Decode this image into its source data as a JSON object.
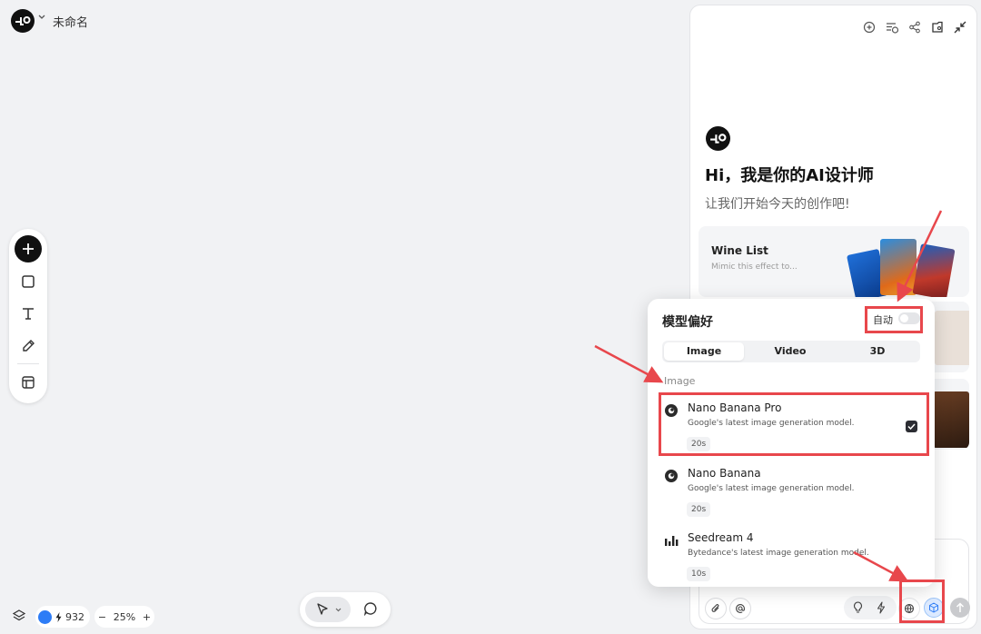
{
  "app": {
    "title": "未命名"
  },
  "credits": {
    "value": "932"
  },
  "zoom": {
    "level": "25%",
    "minus": "−",
    "plus": "+"
  },
  "chat": {
    "greeting": "Hi，我是你的AI设计师",
    "subtitle": "让我们开始今天的创作吧!",
    "cards": [
      {
        "title": "Wine List",
        "desc": "Mimic this effect to..."
      }
    ]
  },
  "model_popup": {
    "title": "模型偏好",
    "auto_label": "自动",
    "auto_enabled": false,
    "tabs": [
      {
        "label": "Image",
        "active": true
      },
      {
        "label": "Video",
        "active": false
      },
      {
        "label": "3D",
        "active": false
      }
    ],
    "section": "Image",
    "models": [
      {
        "name": "Nano Banana Pro",
        "desc": "Google's latest image generation model.",
        "time": "20s",
        "selected": true,
        "icon": "banana-logo-icon"
      },
      {
        "name": "Nano Banana",
        "desc": "Google's latest image generation model.",
        "time": "20s",
        "selected": false,
        "icon": "banana-logo-icon"
      },
      {
        "name": "Seedream 4",
        "desc": "Bytedance's latest image generation model.",
        "time": "10s",
        "selected": false,
        "icon": "bytedance-logo-icon"
      }
    ]
  },
  "colors": {
    "highlight": "#e8474c",
    "accent": "#2d7cf6"
  }
}
